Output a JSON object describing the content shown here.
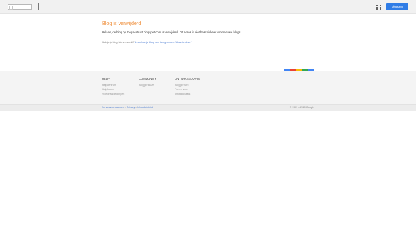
{
  "header": {
    "logo_alt": "",
    "signin_label": "bloggen"
  },
  "main": {
    "title": "Blog is verwijderd",
    "message_prefix": "Helaas, de blog op",
    "blog_url": "thepacetrust.blogspot.com",
    "message_suffix": "is verwijderd. Dit adres is niet beschikbaar voor nieuwe blogs.",
    "question": "Heb je je blog hier verwerkt?",
    "help_link": "Lees hoe je blog kunt terug vinden. Waar is deze?"
  },
  "footer": {
    "columns": [
      {
        "heading": "HELP",
        "links": [
          "Helpcentrum",
          "Helpforum",
          "Videohandleidingen"
        ]
      },
      {
        "heading": "COMMUNITY",
        "links": [
          "Blogger Buzz"
        ]
      },
      {
        "heading": "ONTWIKKELAARS",
        "links": [
          "Blogger API",
          "Forum voor",
          "ontwikkelaars"
        ]
      }
    ],
    "color_bar": [
      "#4285f4",
      "#ea4335",
      "#fbbc05",
      "#34a853",
      "#4285f4"
    ]
  },
  "bottom": {
    "terms": "Servicevoorwaarden",
    "privacy": "Privacy",
    "content_policy": "Inhoudsbeleid",
    "copyright": "© 1999 – 2020 Google"
  }
}
